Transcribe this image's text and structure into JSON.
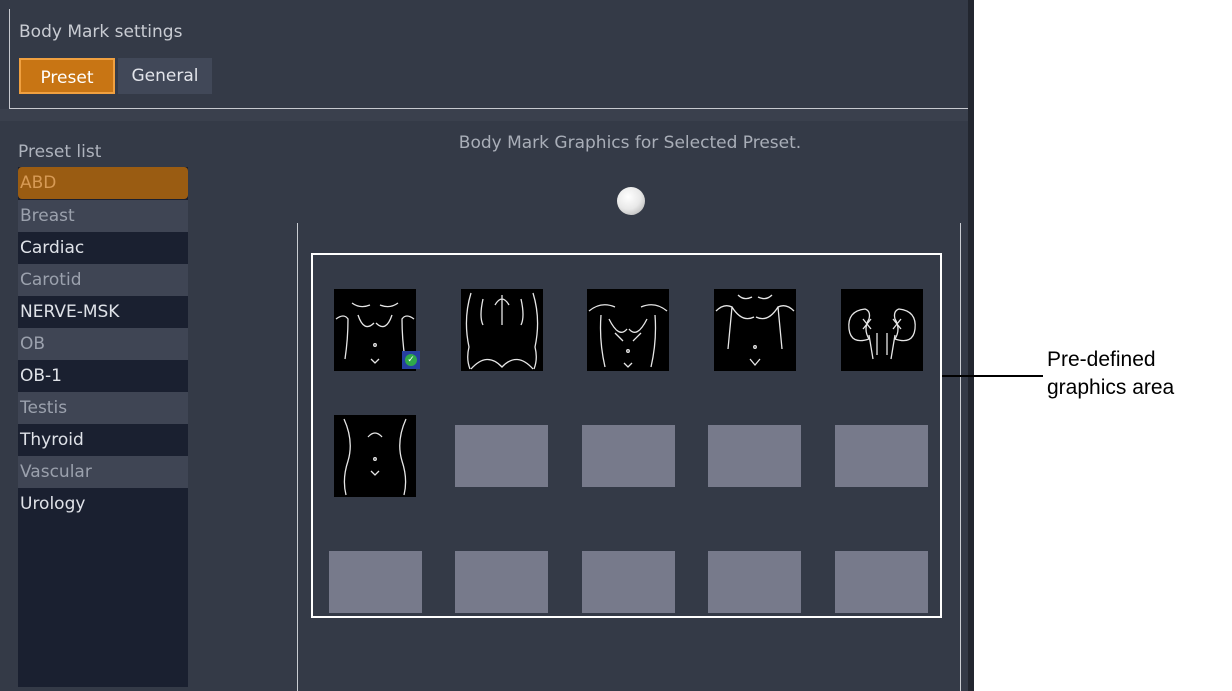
{
  "header": {
    "title": "Body Mark settings",
    "tabs": [
      {
        "label": "Preset",
        "selected": true
      },
      {
        "label": "General",
        "selected": false
      }
    ]
  },
  "preset_list": {
    "label": "Preset list",
    "items": [
      {
        "label": "ABD",
        "selected": true
      },
      {
        "label": "Breast"
      },
      {
        "label": "Cardiac"
      },
      {
        "label": "Carotid"
      },
      {
        "label": "NERVE-MSK"
      },
      {
        "label": "OB"
      },
      {
        "label": "OB-1"
      },
      {
        "label": "Testis"
      },
      {
        "label": "Thyroid"
      },
      {
        "label": "Vascular"
      },
      {
        "label": "Urology"
      }
    ]
  },
  "graphics": {
    "title": "Body Mark Graphics for Selected Preset.",
    "thumbnails": [
      {
        "icon": "abdomen-front-icon",
        "default": true
      },
      {
        "icon": "back-torso-icon"
      },
      {
        "icon": "chest-front-icon"
      },
      {
        "icon": "torso-front-icon"
      },
      {
        "icon": "kidneys-icon"
      },
      {
        "icon": "lower-abdomen-icon"
      }
    ],
    "empty_slots": 9
  },
  "callout": {
    "line1": "Pre-defined",
    "line2": "graphics area"
  },
  "colors": {
    "background": "#343a47",
    "accent": "#c87514",
    "list_background": "#1a2030",
    "placeholder": "#777a8b"
  }
}
